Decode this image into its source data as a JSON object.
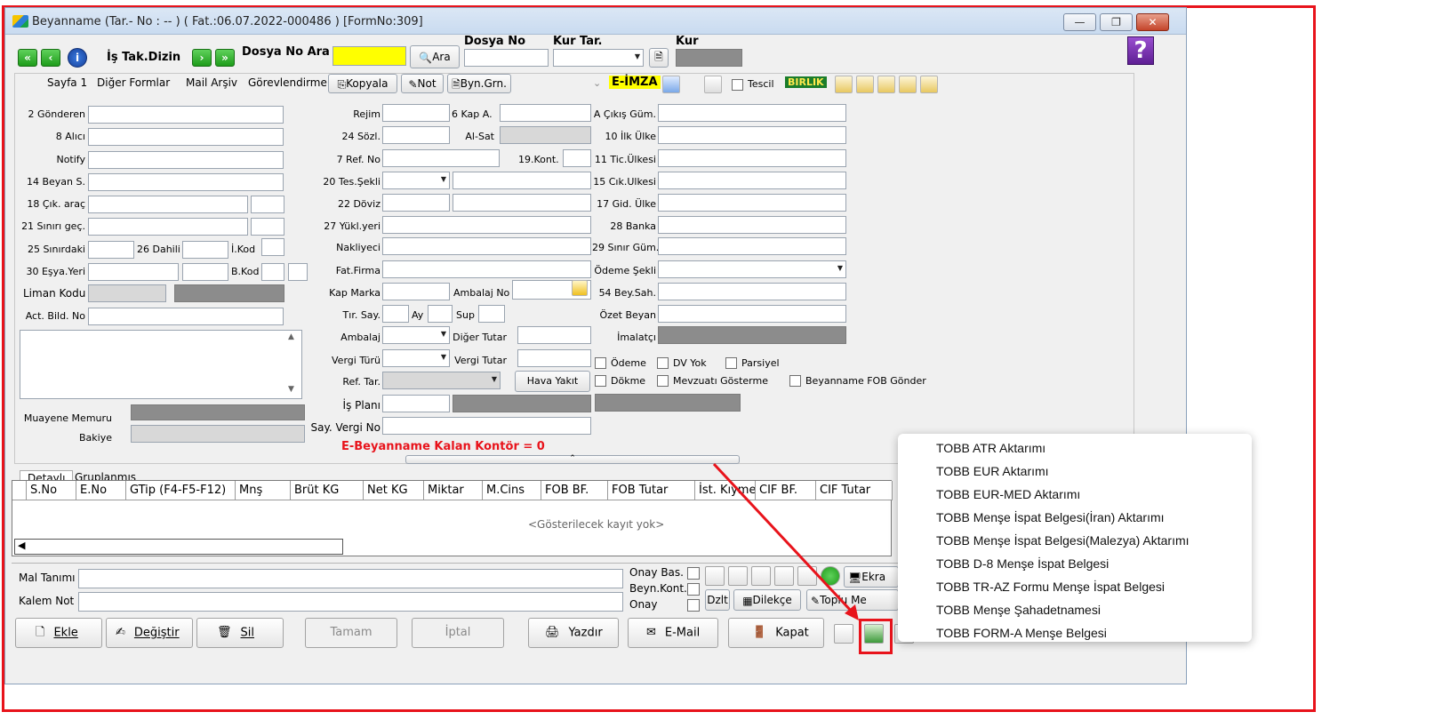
{
  "window": {
    "title": "Beyanname (Tar.- No :  -- ) ( Fat.:06.07.2022-000486 )  [FormNo:309]"
  },
  "toolbar": {
    "nav_first": "«",
    "nav_prev": "‹",
    "nav_next": "›",
    "nav_last": "»",
    "info": "i",
    "is_takip_dizin": "İş Tak.Dizin",
    "dosya_no_ara": "Dosya No Ara",
    "ara_button": "Ara",
    "dosya_no_label": "Dosya No",
    "kur_tar_label": "Kur Tar.",
    "kur_label": "Kur",
    "help": "?"
  },
  "tabs": [
    "Sayfa 1",
    "Diğer Formlar",
    "Mail Arşiv",
    "Görevlendirme"
  ],
  "panel_buttons": {
    "kopyala": "Kopyala",
    "not": "Not",
    "byn_grn": "Byn.Grn.",
    "e_imza": "E-İMZA",
    "tescil": "Tescil",
    "birlik": "BIRLIK"
  },
  "left_fields": [
    "2 Gönderen",
    "8 Alıcı",
    "Notify",
    "14 Beyan S.",
    "18 Çık. araç",
    "21 Sınırı geç.",
    "25 Sınırdaki",
    "26 Dahili",
    "İ.Kod",
    "30 Eşya.Yeri",
    "B.Kod",
    "Liman Kodu",
    "Act. Bild. No",
    "Muayene Memuru",
    "Bakiye"
  ],
  "mid_fields": [
    "Rejim",
    "6 Kap A.",
    "24 Sözl.",
    "Al-Sat",
    "7 Ref. No",
    "19.Kont.",
    "20 Tes.Şekli",
    "22 Döviz",
    "27 Yükl.yeri",
    "Nakliyeci",
    "Fat.Firma",
    "Kap Marka",
    "Ambalaj No",
    "Tır. Say.",
    "Ay",
    "Sup",
    "Ambalaj",
    "Diğer Tutar",
    "Vergi Türü",
    "Vergi Tutar",
    "Ref. Tar.",
    "Hava Yakıt",
    "İş Planı",
    "Say. Vergi No"
  ],
  "right_fields": [
    "A Çıkış Güm.",
    "10 İlk Ülke",
    "11 Tic.Ülkesi",
    "15 Cık.Ulkesi",
    "17 Gid. Ülke",
    "28 Banka",
    "29 Sınır Güm.",
    "Ödeme Şekli",
    "54 Bey.Sah.",
    "Özet Beyan",
    "İmalatçı"
  ],
  "checkboxes": [
    "Ödeme",
    "DV Yok",
    "Parsiyel",
    "Dökme",
    "Mevzuatı Gösterme",
    "Beyanname FOB Gönder"
  ],
  "kontor": "E-Beyanname Kalan Kontör = 0",
  "grid": {
    "tabs": [
      "Detaylı",
      "Gruplanmış"
    ],
    "columns": [
      "S.No",
      "E.No",
      "GTip (F4-F5-F12)",
      "Mnş",
      "Brüt KG",
      "Net KG",
      "Miktar",
      "M.Cins",
      "FOB BF.",
      "FOB Tutar",
      "İst. Kıymet",
      "CIF BF.",
      "CIF Tutar"
    ],
    "empty": "<Gösterilecek kayıt yok>"
  },
  "lower": {
    "mal_tanimi": "Mal Tanımı",
    "kalem_not": "Kalem Not",
    "onay_bas": "Onay Bas.",
    "beyn_kont": "Beyn.Kont.",
    "onay": "Onay",
    "dzlt": "Dzlt",
    "dilekce": "Dilekçe",
    "ekra": "Ekra",
    "toplu_me": "Toplu Me"
  },
  "bottom_buttons": {
    "ekle": "Ekle",
    "degistir": "Değiştir",
    "sil": "Sil",
    "tamam": "Tamam",
    "iptal": "İptal",
    "yazdir": "Yazdır",
    "email": "E-Mail",
    "kapat": "Kapat"
  },
  "menu": [
    "TOBB ATR Aktarımı",
    "TOBB EUR Aktarımı",
    "TOBB EUR-MED Aktarımı",
    "TOBB Menşe İspat Belgesi(İran) Aktarımı",
    "TOBB Menşe İspat Belgesi(Malezya) Aktarımı",
    "TOBB D-8 Menşe İspat Belgesi",
    "TOBB TR-AZ Formu Menşe İspat Belgesi",
    "TOBB Menşe Şahadetnamesi",
    "TOBB FORM-A Menşe Belgesi"
  ],
  "colors": {
    "annotation_red": "#e8131b",
    "yellow_field": "#ffff00",
    "kontor_red": "#e8131b"
  }
}
